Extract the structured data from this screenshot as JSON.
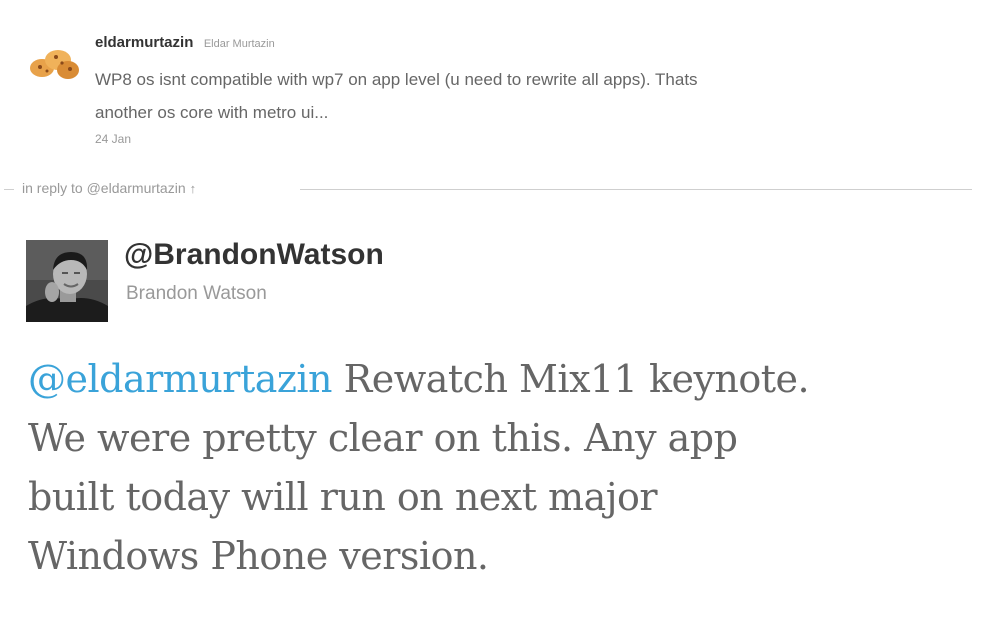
{
  "original_tweet": {
    "avatar_icon": "cookie-avatar-icon",
    "screen_name": "eldarmurtazin",
    "full_name": "Eldar Murtazin",
    "text_line1": "WP8 os isnt compatible with wp7 on app level (u need to rewrite all apps). Thats",
    "text_line2": "another os core with metro ui...",
    "timestamp": "24 Jan"
  },
  "reply_divider": {
    "label": "in reply to @eldarmurtazin",
    "arrow_icon": "up-arrow-icon"
  },
  "main_tweet": {
    "avatar_icon": "profile-photo-avatar",
    "screen_name": "@BrandonWatson",
    "full_name": "Brandon Watson",
    "mention": "@eldarmurtazin",
    "text_line1_rest": " Rewatch Mix11 keynote.",
    "text_line2": "We were pretty clear on this. Any app",
    "text_line3": "built today will run on next major",
    "text_line4": "Windows Phone version.",
    "link_color": "#3aa3d9"
  }
}
